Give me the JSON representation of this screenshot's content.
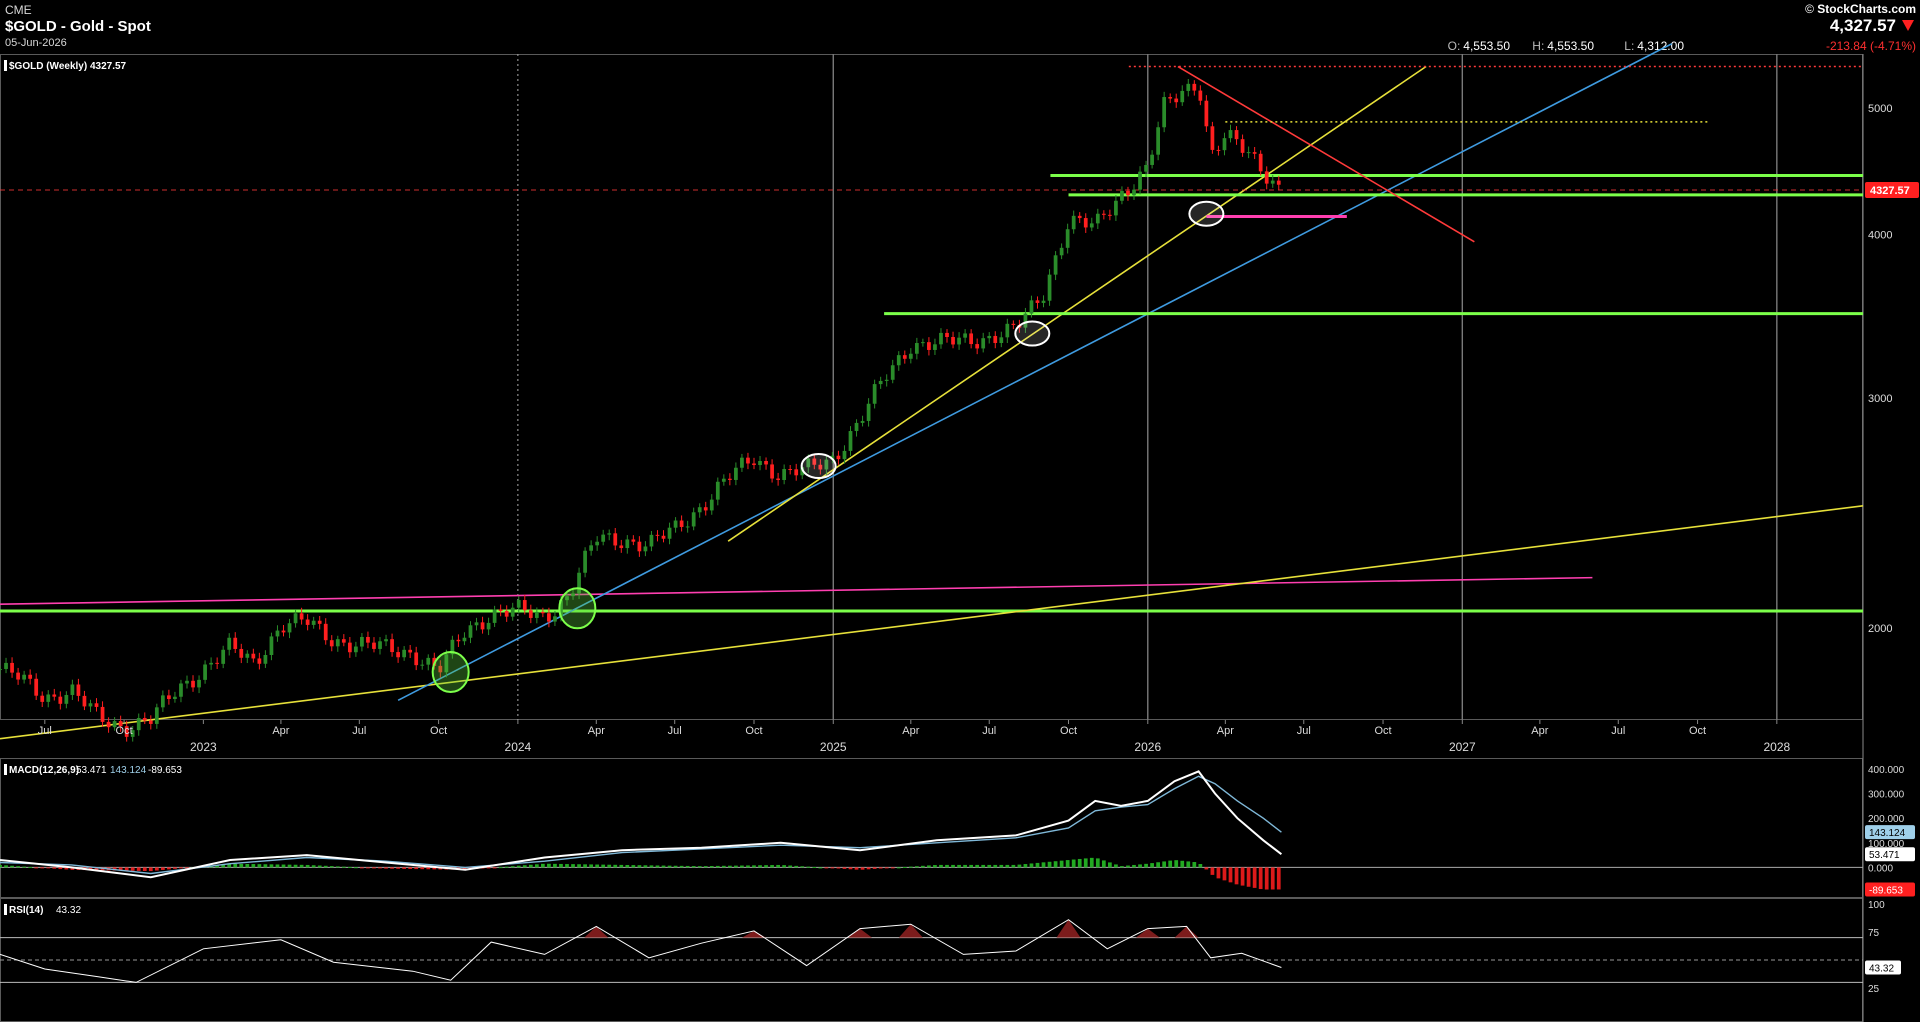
{
  "header": {
    "exchange": "CME",
    "title": "$GOLD - Gold - Spot",
    "date": "05-Jun-2026",
    "logo": "StockCharts.com",
    "last": "4,327.57",
    "open_label": "O:",
    "open": "4,553.50",
    "high_label": "H:",
    "high": "4,553.50",
    "low_label": "L:",
    "low": "4,312.00",
    "change": "-213.84 (-4.71%)",
    "direction": "down"
  },
  "colors": {
    "background": "#000000",
    "header_bg": "#000000",
    "up_candle": "#2a8c2a",
    "down_candle": "#ff1f1f",
    "grid": "#7a7a7a",
    "green_line": "#7cff4a",
    "magenta_line": "#ff3fb0",
    "yellow_line": "#e6e03a",
    "blue_line": "#3f9be0",
    "red_line": "#ff3a3a",
    "macd_line": "#ffffff",
    "signal_line": "#7fb8d8",
    "price_tag": "#ff2020"
  },
  "chart_data": [
    {
      "type": "candlestick",
      "title": "$GOLD (Weekly) 4327.57",
      "scale": "log",
      "y_ticks": [
        2000,
        3000,
        4000,
        5000
      ],
      "y_tick_labels": [
        "2000",
        "3000",
        "4000",
        "5000"
      ],
      "ylim": [
        1700,
        5500
      ],
      "xlim": [
        "2022-05-10",
        "2028-04-10"
      ],
      "x_ticks": [
        {
          "date": "2022-07-01",
          "label": "Jul"
        },
        {
          "date": "2022-10-01",
          "label": "Oct"
        },
        {
          "date": "2023-01-01",
          "label": "2023"
        },
        {
          "date": "2023-04-01",
          "label": "Apr"
        },
        {
          "date": "2023-07-01",
          "label": "Jul"
        },
        {
          "date": "2023-10-01",
          "label": "Oct"
        },
        {
          "date": "2024-01-01",
          "label": "2024"
        },
        {
          "date": "2024-04-01",
          "label": "Apr"
        },
        {
          "date": "2024-07-01",
          "label": "Jul"
        },
        {
          "date": "2024-10-01",
          "label": "Oct"
        },
        {
          "date": "2025-01-01",
          "label": "2025"
        },
        {
          "date": "2025-04-01",
          "label": "Apr"
        },
        {
          "date": "2025-07-01",
          "label": "Jul"
        },
        {
          "date": "2025-10-01",
          "label": "Oct"
        },
        {
          "date": "2026-01-01",
          "label": "2026"
        },
        {
          "date": "2026-04-01",
          "label": "Apr"
        },
        {
          "date": "2026-07-01",
          "label": "Jul"
        },
        {
          "date": "2026-10-01",
          "label": "Oct"
        },
        {
          "date": "2027-01-01",
          "label": "2027"
        },
        {
          "date": "2027-04-01",
          "label": "Apr"
        },
        {
          "date": "2027-07-01",
          "label": "Jul"
        },
        {
          "date": "2027-10-01",
          "label": "Oct"
        },
        {
          "date": "2028-01-01",
          "label": "2028"
        }
      ],
      "year_lines": [
        "2025-01-01",
        "2026-01-01",
        "2027-01-01",
        "2028-01-01"
      ],
      "dotted_line": "2024-01-01",
      "last_price_label": "4327.57",
      "price_path": [
        [
          "2022-05-10",
          1860
        ],
        [
          "2022-06-01",
          1830
        ],
        [
          "2022-07-01",
          1770
        ],
        [
          "2022-08-01",
          1790
        ],
        [
          "2022-09-01",
          1705
        ],
        [
          "2022-10-01",
          1680
        ],
        [
          "2022-11-01",
          1700
        ],
        [
          "2022-12-01",
          1790
        ],
        [
          "2023-01-01",
          1860
        ],
        [
          "2023-02-01",
          1930
        ],
        [
          "2023-03-01",
          1880
        ],
        [
          "2023-04-01",
          2010
        ],
        [
          "2023-05-01",
          2020
        ],
        [
          "2023-06-01",
          1960
        ],
        [
          "2023-07-01",
          1940
        ],
        [
          "2023-08-01",
          1930
        ],
        [
          "2023-09-01",
          1915
        ],
        [
          "2023-10-01",
          1850
        ],
        [
          "2023-11-01",
          1990
        ],
        [
          "2023-12-01",
          2050
        ],
        [
          "2024-01-01",
          2060
        ],
        [
          "2024-02-01",
          2040
        ],
        [
          "2024-03-01",
          2120
        ],
        [
          "2024-04-01",
          2340
        ],
        [
          "2024-05-01",
          2340
        ],
        [
          "2024-06-01",
          2310
        ],
        [
          "2024-07-01",
          2380
        ],
        [
          "2024-08-01",
          2480
        ],
        [
          "2024-09-01",
          2600
        ],
        [
          "2024-10-01",
          2700
        ],
        [
          "2024-11-01",
          2620
        ],
        [
          "2024-12-01",
          2640
        ],
        [
          "2025-01-01",
          2700
        ],
        [
          "2025-02-01",
          2880
        ],
        [
          "2025-03-01",
          3100
        ],
        [
          "2025-04-01",
          3300
        ],
        [
          "2025-05-01",
          3300
        ],
        [
          "2025-06-01",
          3320
        ],
        [
          "2025-07-01",
          3340
        ],
        [
          "2025-08-01",
          3380
        ],
        [
          "2025-09-01",
          3600
        ],
        [
          "2025-10-01",
          4100
        ],
        [
          "2025-11-01",
          4050
        ],
        [
          "2025-12-01",
          4300
        ],
        [
          "2026-01-01",
          4500
        ],
        [
          "2026-01-20",
          5000
        ],
        [
          "2026-02-10",
          5150
        ],
        [
          "2026-03-01",
          5250
        ],
        [
          "2026-03-15",
          4600
        ],
        [
          "2026-04-01",
          4750
        ],
        [
          "2026-05-01",
          4600
        ],
        [
          "2026-06-05",
          4327.57
        ]
      ],
      "overlays": [
        {
          "kind": "hline",
          "value": 2060,
          "from": "2022-05-10",
          "to": "2028-04-10",
          "color": "green"
        },
        {
          "kind": "line",
          "p1": [
            "2022-05-10",
            2085
          ],
          "p2": [
            "2027-06-01",
            2185
          ],
          "color": "magenta"
        },
        {
          "kind": "line",
          "p1": [
            "2022-05-10",
            1645
          ],
          "p2": [
            "2028-04-10",
            2480
          ],
          "color": "yellow"
        },
        {
          "kind": "line",
          "p1": [
            "2023-08-15",
            1760
          ],
          "p2": [
            "2027-09-01",
            5600
          ],
          "color": "blue"
        },
        {
          "kind": "line",
          "p1": [
            "2024-09-01",
            2330
          ],
          "p2": [
            "2026-11-20",
            5380
          ],
          "color": "yellow"
        },
        {
          "kind": "hline",
          "value": 3480,
          "from": "2025-03-01",
          "to": "2028-04-10",
          "color": "green"
        },
        {
          "kind": "hline",
          "value": 4440,
          "from": "2025-09-10",
          "to": "2028-04-10",
          "color": "green"
        },
        {
          "kind": "hline",
          "value": 4290,
          "from": "2025-10-01",
          "to": "2028-04-10",
          "color": "green"
        },
        {
          "kind": "hline",
          "value": 4130,
          "from": "2026-03-10",
          "to": "2026-08-20",
          "color": "magenta"
        },
        {
          "kind": "line",
          "p1": [
            "2026-02-05",
            5380
          ],
          "p2": [
            "2027-01-15",
            3950
          ],
          "color": "red"
        },
        {
          "kind": "hline",
          "value": 4880,
          "from": "2026-04-01",
          "to": "2027-10-15",
          "color": "yellow",
          "dotted": true
        },
        {
          "kind": "hline",
          "value": 5380,
          "from": "2025-12-10",
          "to": "2028-04-10",
          "color": "red",
          "dotted": true
        },
        {
          "kind": "hline",
          "value": 4327.57,
          "from": "2022-05-10",
          "to": "2028-04-10",
          "color": "red",
          "dashed": true
        }
      ],
      "circles": [
        {
          "date": "2023-10-15",
          "value": 1850,
          "color": "green"
        },
        {
          "date": "2024-03-10",
          "value": 2070,
          "color": "green"
        },
        {
          "date": "2024-12-15",
          "value": 2660,
          "color": "white"
        },
        {
          "date": "2025-08-20",
          "value": 3360,
          "color": "white"
        },
        {
          "date": "2026-03-10",
          "value": 4150,
          "color": "white"
        }
      ]
    },
    {
      "type": "line",
      "title": "MACD(12,26,9) 53.471",
      "label": "MACD(12,26,9)",
      "macd_value": "53.471",
      "signal_value": "143.124",
      "hist_value": "-89.653",
      "y_ticks": [
        -100,
        0,
        100,
        200,
        300,
        400
      ],
      "y_tick_labels": [
        "",
        "0.000",
        "100.000",
        "200.000",
        "300.000",
        "400.000"
      ],
      "ylim": [
        -100,
        420
      ],
      "macd_path": [
        [
          "2022-05-10",
          30
        ],
        [
          "2022-08-01",
          0
        ],
        [
          "2022-11-01",
          -40
        ],
        [
          "2023-02-01",
          30
        ],
        [
          "2023-05-01",
          50
        ],
        [
          "2023-08-01",
          20
        ],
        [
          "2023-11-01",
          -10
        ],
        [
          "2024-02-01",
          40
        ],
        [
          "2024-05-01",
          70
        ],
        [
          "2024-08-01",
          80
        ],
        [
          "2024-11-01",
          100
        ],
        [
          "2025-02-01",
          70
        ],
        [
          "2025-05-01",
          110
        ],
        [
          "2025-08-01",
          130
        ],
        [
          "2025-10-01",
          190
        ],
        [
          "2025-11-01",
          270
        ],
        [
          "2025-12-01",
          250
        ],
        [
          "2026-01-01",
          270
        ],
        [
          "2026-02-01",
          350
        ],
        [
          "2026-03-01",
          390
        ],
        [
          "2026-03-20",
          300
        ],
        [
          "2026-04-15",
          200
        ],
        [
          "2026-05-15",
          110
        ],
        [
          "2026-06-05",
          53.471
        ]
      ],
      "signal_path": [
        [
          "2022-05-10",
          20
        ],
        [
          "2022-08-01",
          10
        ],
        [
          "2022-11-01",
          -25
        ],
        [
          "2023-02-01",
          15
        ],
        [
          "2023-05-01",
          40
        ],
        [
          "2023-08-01",
          25
        ],
        [
          "2023-11-01",
          0
        ],
        [
          "2024-02-01",
          25
        ],
        [
          "2024-05-01",
          60
        ],
        [
          "2024-08-01",
          75
        ],
        [
          "2024-11-01",
          90
        ],
        [
          "2025-02-01",
          80
        ],
        [
          "2025-05-01",
          100
        ],
        [
          "2025-08-01",
          120
        ],
        [
          "2025-10-01",
          160
        ],
        [
          "2025-11-01",
          230
        ],
        [
          "2025-12-01",
          245
        ],
        [
          "2026-01-01",
          255
        ],
        [
          "2026-02-01",
          320
        ],
        [
          "2026-03-01",
          370
        ],
        [
          "2026-03-20",
          340
        ],
        [
          "2026-04-15",
          270
        ],
        [
          "2026-05-15",
          200
        ],
        [
          "2026-06-05",
          143.124
        ]
      ]
    },
    {
      "type": "line",
      "title": "RSI(14) 43.32",
      "label": "RSI(14)",
      "value": "43.32",
      "y_ticks": [
        25,
        50,
        75,
        100
      ],
      "y_tick_labels": [
        "25",
        "",
        "75",
        "100"
      ],
      "ylim": [
        0,
        100
      ],
      "overbought": 70,
      "oversold": 30,
      "rsi_path": [
        [
          "2022-05-10",
          55
        ],
        [
          "2022-07-01",
          42
        ],
        [
          "2022-09-01",
          35
        ],
        [
          "2022-10-15",
          30
        ],
        [
          "2023-01-01",
          60
        ],
        [
          "2023-04-01",
          68
        ],
        [
          "2023-06-01",
          48
        ],
        [
          "2023-09-01",
          40
        ],
        [
          "2023-10-15",
          32
        ],
        [
          "2023-12-01",
          66
        ],
        [
          "2024-02-01",
          55
        ],
        [
          "2024-04-01",
          80
        ],
        [
          "2024-06-01",
          52
        ],
        [
          "2024-08-01",
          65
        ],
        [
          "2024-10-01",
          76
        ],
        [
          "2024-12-01",
          45
        ],
        [
          "2025-02-01",
          78
        ],
        [
          "2025-04-01",
          82
        ],
        [
          "2025-06-01",
          55
        ],
        [
          "2025-08-01",
          58
        ],
        [
          "2025-10-01",
          86
        ],
        [
          "2025-11-15",
          60
        ],
        [
          "2026-01-01",
          78
        ],
        [
          "2026-02-15",
          80
        ],
        [
          "2026-03-15",
          52
        ],
        [
          "2026-04-20",
          56
        ],
        [
          "2026-06-05",
          43.32
        ]
      ]
    }
  ]
}
